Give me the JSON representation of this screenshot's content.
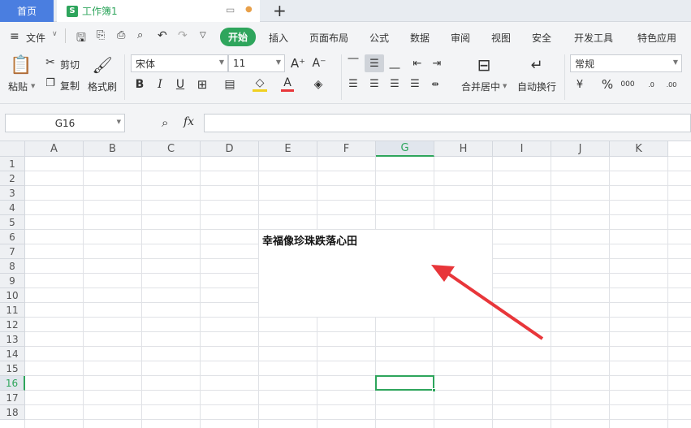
{
  "tabs": {
    "home": "首页",
    "doc": "工作簿1",
    "add": "+"
  },
  "menu": {
    "file": "文件",
    "items": [
      "开始",
      "插入",
      "页面布局",
      "公式",
      "数据",
      "审阅",
      "视图",
      "安全",
      "开发工具",
      "特色应用"
    ]
  },
  "ribbon": {
    "paste": "粘贴",
    "cut": "剪切",
    "copy": "复制",
    "format_painter": "格式刷",
    "font_name": "宋体",
    "font_size": "11",
    "merge_center": "合并居中",
    "wrap_text": "自动换行",
    "number_format": "常规"
  },
  "formula_bar": {
    "cell_ref": "G16",
    "fx": "fx",
    "value": ""
  },
  "sheet": {
    "columns": [
      "A",
      "B",
      "C",
      "D",
      "E",
      "F",
      "G",
      "H",
      "I",
      "J",
      "K"
    ],
    "rows": [
      "1",
      "2",
      "3",
      "4",
      "5",
      "6",
      "7",
      "8",
      "9",
      "10",
      "11",
      "12",
      "13",
      "14",
      "15",
      "16",
      "17",
      "18"
    ],
    "active_column": "G",
    "active_row": "16",
    "merged_cell_text": "幸福像珍珠跌落心田"
  },
  "colors": {
    "accent": "#2ea55c",
    "home_tab": "#4a7ee0",
    "arrow": "#e8363a"
  }
}
